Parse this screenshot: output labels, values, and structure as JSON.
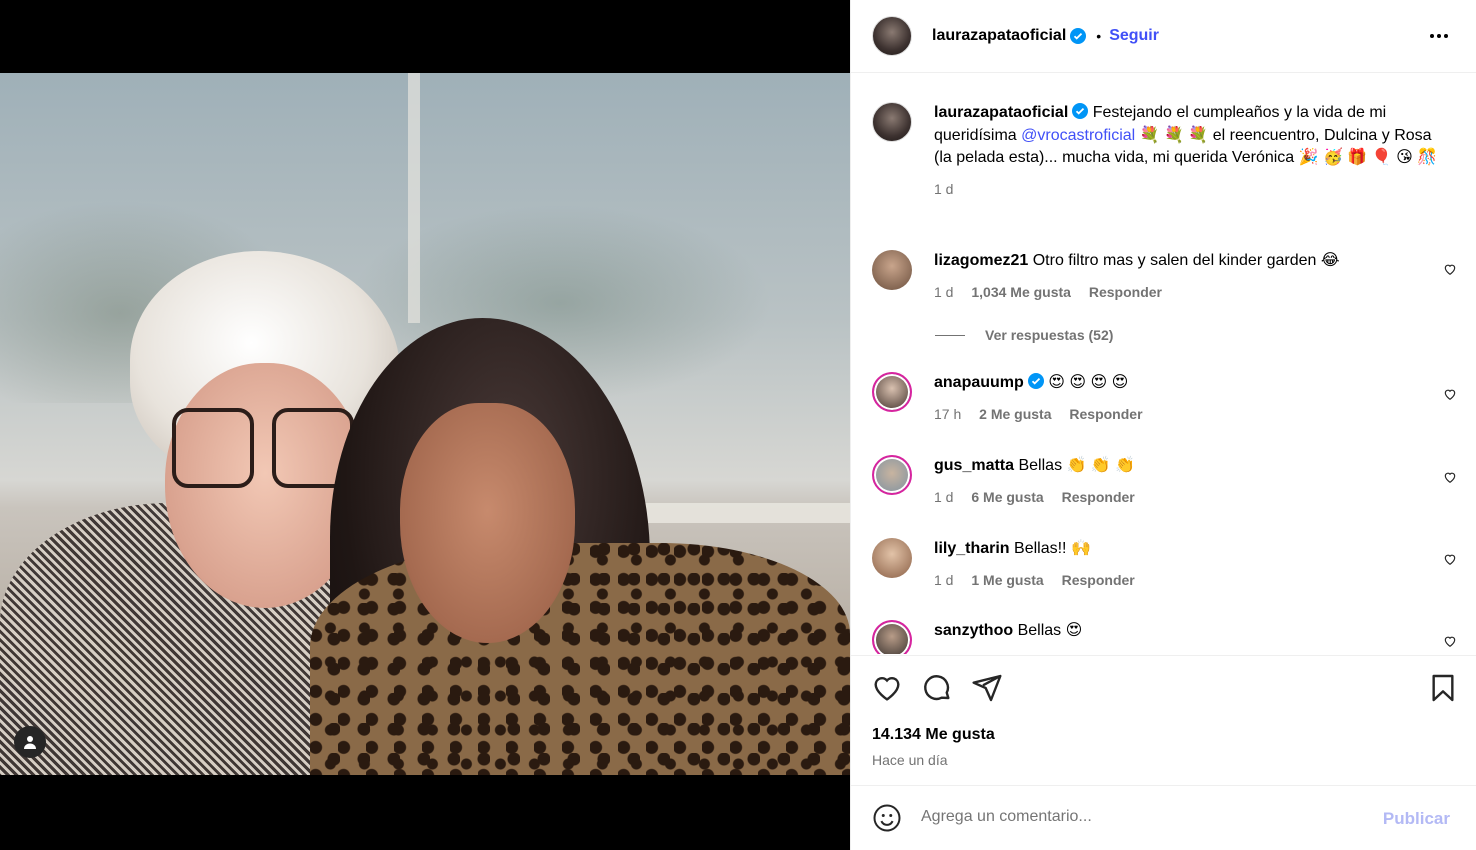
{
  "post": {
    "username": "laurazapataoficial",
    "follow_label": "Seguir",
    "separator": "•",
    "caption_parts": {
      "text_before": "Festejando el cumpleaños y la vida de mi queridísima",
      "mention": "@vrocastroficial",
      "text_after": "💐 💐 💐  el reencuentro, Dulcina y Rosa (la pelada esta)... mucha vida, mi querida Verónica 🎉 🥳 🎁 🎈 😘 🎊"
    },
    "caption_time": "1 d",
    "likes": "14.134 Me gusta",
    "posted_ago": "Hace un día"
  },
  "replies_label": "Ver respuestas (52)",
  "comments": [
    {
      "username": "lizagomez21",
      "text": "Otro filtro mas y salen del kinder garden 😂",
      "time": "1 d",
      "likes": "1,034 Me gusta",
      "reply": "Responder",
      "verified": false
    },
    {
      "username": "anapauump",
      "text": "😍 😍 😍 😍",
      "time": "17 h",
      "likes": "2 Me gusta",
      "reply": "Responder",
      "verified": true
    },
    {
      "username": "gus_matta",
      "text": "Bellas 👏 👏 👏",
      "time": "1 d",
      "likes": "6 Me gusta",
      "reply": "Responder",
      "verified": false
    },
    {
      "username": "lily_tharin",
      "text": "Bellas!! 🙌",
      "time": "1 d",
      "likes": "1 Me gusta",
      "reply": "Responder",
      "verified": false
    },
    {
      "username": "sanzythoo",
      "text": "Bellas 😍",
      "time": "",
      "likes": "",
      "reply": "",
      "verified": false
    }
  ],
  "composer": {
    "placeholder": "Agrega un comentario...",
    "publish_label": "Publicar"
  },
  "icons": {
    "header_more": "more-horizontal-icon",
    "like": "heart-icon",
    "comment": "comment-icon",
    "share": "send-icon",
    "save": "bookmark-icon",
    "emoji": "emoji-icon",
    "user_tag": "user-tag-icon"
  },
  "colors": {
    "link_blue": "#4150f7",
    "muted_text": "#737373",
    "publish_disabled": "#b3b9f5",
    "verified_blue": "#0095f6"
  }
}
